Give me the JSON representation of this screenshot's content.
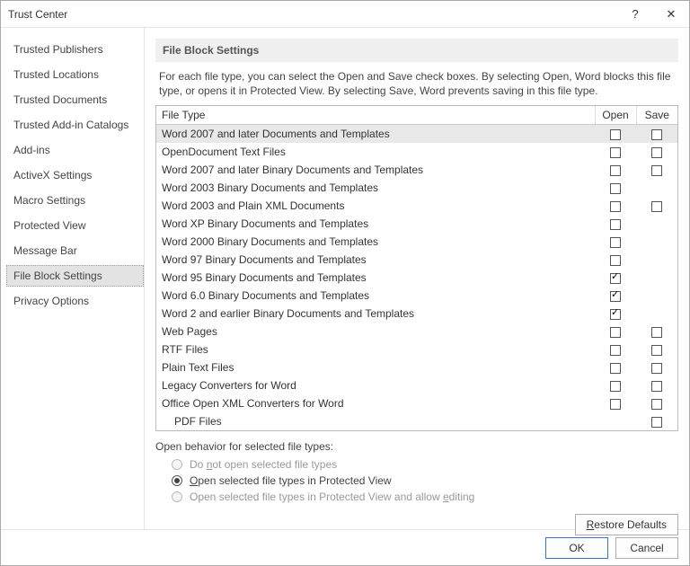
{
  "window": {
    "title": "Trust Center"
  },
  "sidebar": {
    "items": [
      {
        "label": "Trusted Publishers",
        "selected": false
      },
      {
        "label": "Trusted Locations",
        "selected": false
      },
      {
        "label": "Trusted Documents",
        "selected": false
      },
      {
        "label": "Trusted Add-in Catalogs",
        "selected": false
      },
      {
        "label": "Add-ins",
        "selected": false
      },
      {
        "label": "ActiveX Settings",
        "selected": false
      },
      {
        "label": "Macro Settings",
        "selected": false
      },
      {
        "label": "Protected View",
        "selected": false
      },
      {
        "label": "Message Bar",
        "selected": false
      },
      {
        "label": "File Block Settings",
        "selected": true
      },
      {
        "label": "Privacy Options",
        "selected": false
      }
    ]
  },
  "main": {
    "section_title": "File Block Settings",
    "description": "For each file type, you can select the Open and Save check boxes. By selecting Open, Word blocks this file type, or opens it in Protected View. By selecting Save, Word prevents saving in this file type.",
    "table": {
      "headers": {
        "type": "File Type",
        "open": "Open",
        "save": "Save"
      },
      "rows": [
        {
          "label": "Word 2007 and later Documents and Templates",
          "open": false,
          "save": false,
          "highlight": true
        },
        {
          "label": "OpenDocument Text Files",
          "open": false,
          "save": false
        },
        {
          "label": "Word 2007 and later Binary Documents and Templates",
          "open": false,
          "save": false
        },
        {
          "label": "Word 2003 Binary Documents and Templates",
          "open": false,
          "save": null
        },
        {
          "label": "Word 2003 and Plain XML Documents",
          "open": false,
          "save": false
        },
        {
          "label": "Word XP Binary Documents and Templates",
          "open": false,
          "save": null
        },
        {
          "label": "Word 2000 Binary Documents and Templates",
          "open": false,
          "save": null
        },
        {
          "label": "Word 97 Binary Documents and Templates",
          "open": false,
          "save": null
        },
        {
          "label": "Word 95 Binary Documents and Templates",
          "open": true,
          "save": null
        },
        {
          "label": "Word 6.0 Binary Documents and Templates",
          "open": true,
          "save": null
        },
        {
          "label": "Word 2 and earlier Binary Documents and Templates",
          "open": true,
          "save": null
        },
        {
          "label": "Web Pages",
          "open": false,
          "save": false
        },
        {
          "label": "RTF Files",
          "open": false,
          "save": false
        },
        {
          "label": "Plain Text Files",
          "open": false,
          "save": false
        },
        {
          "label": "Legacy Converters for Word",
          "open": false,
          "save": false
        },
        {
          "label": "Office Open XML Converters for Word",
          "open": false,
          "save": false
        },
        {
          "label": "PDF Files",
          "open": null,
          "save": false,
          "indent": true
        }
      ]
    },
    "open_behavior": {
      "title": "Open behavior for selected file types:",
      "options": [
        {
          "label_pre": "Do ",
          "u": "n",
          "label_post": "ot open selected file types",
          "selected": false,
          "disabled": true
        },
        {
          "label_pre": "",
          "u": "O",
          "label_post": "pen selected file types in Protected View",
          "selected": true,
          "disabled": false
        },
        {
          "label_pre": "Open selected file types in Protected View and allow ",
          "u": "e",
          "label_post": "diting",
          "selected": false,
          "disabled": true
        }
      ]
    },
    "restore_button": {
      "u": "R",
      "rest": "estore Defaults"
    }
  },
  "footer": {
    "ok": "OK",
    "cancel": "Cancel"
  }
}
